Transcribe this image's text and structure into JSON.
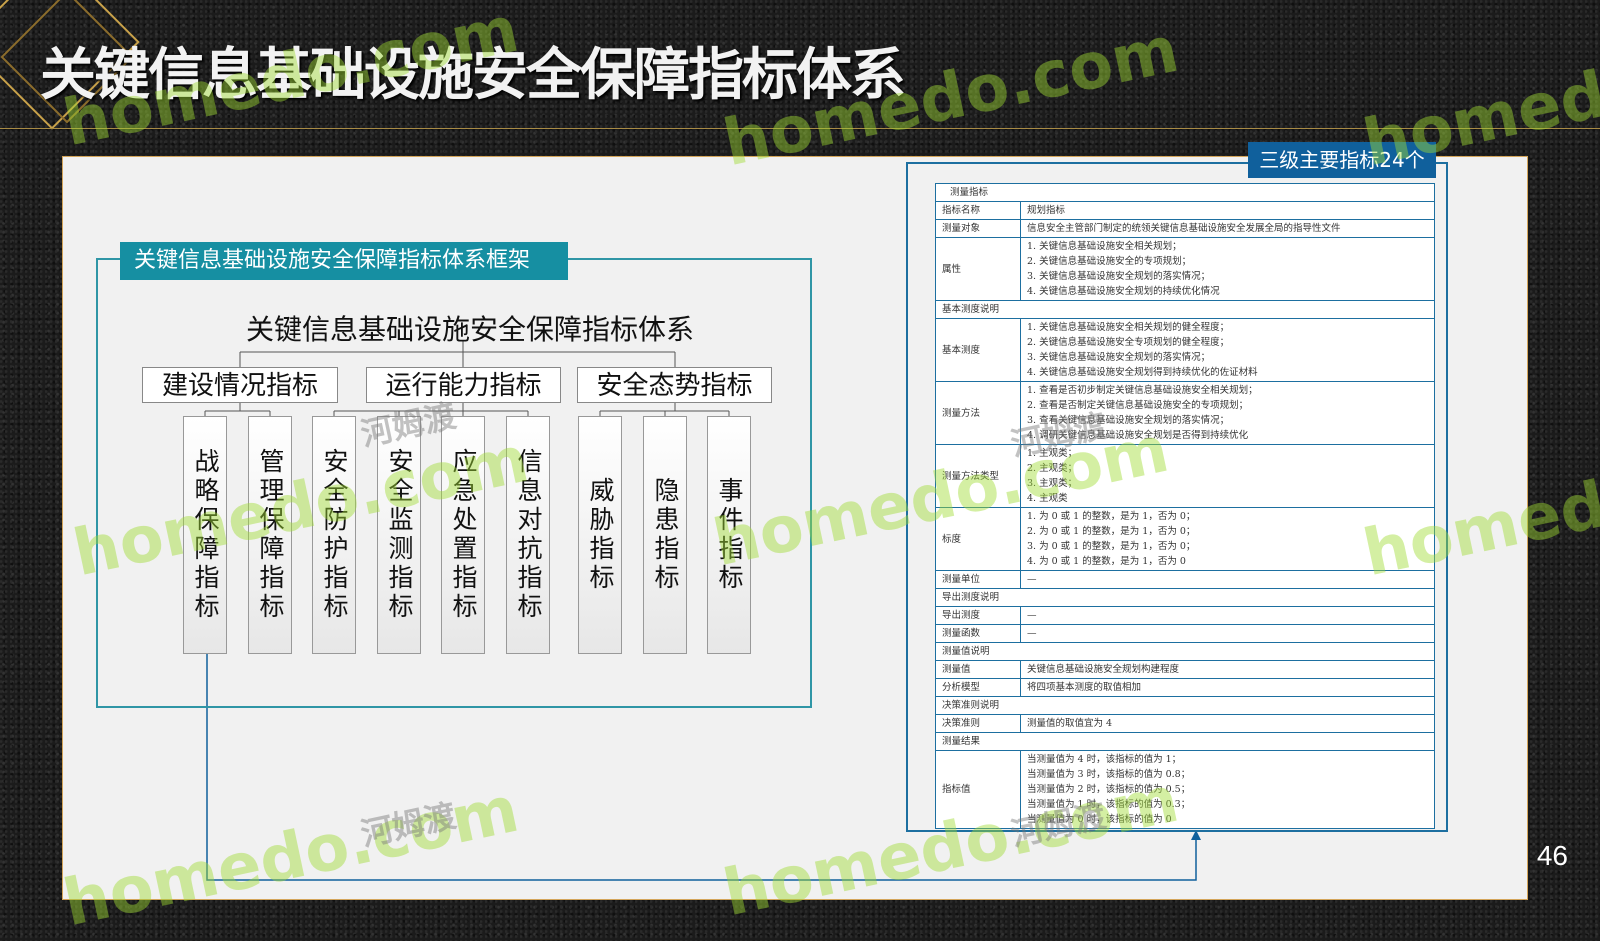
{
  "slide": {
    "title": "关键信息基础设施安全保障指标体系",
    "page_number": "46"
  },
  "framework": {
    "label": "关键信息基础设施安全保障指标体系框架",
    "system_title": "关键信息基础设施安全保障指标体系",
    "categories": [
      {
        "label": "建设情况指标",
        "leaves": [
          "战略保障指标",
          "管理保障指标"
        ]
      },
      {
        "label": "运行能力指标",
        "leaves": [
          "安全防护指标",
          "安全监测指标",
          "应急处置指标",
          "信息对抗指标"
        ]
      },
      {
        "label": "安全态势指标",
        "leaves": [
          "威胁指标",
          "隐患指标",
          "事件指标"
        ]
      }
    ]
  },
  "level_tag": "三级主要指标24个",
  "metric_table": {
    "header": "测量指标",
    "name_key": "指标名称",
    "name_val": "规划指标",
    "object_key": "测量对象",
    "object_val": "信息安全主管部门制定的统领关键信息基础设施安全发展全局的指导性文件",
    "attr_key": "属性",
    "attr_lines": [
      "1. 关键信息基础设施安全相关规划；",
      "2. 关键信息基础设施安全的专项规划；",
      "3. 关键信息基础设施安全规划的落实情况；",
      "4. 关键信息基础设施安全规划的持续优化情况"
    ],
    "basic_desc": "基本测度说明",
    "basic_key": "基本测度",
    "basic_lines": [
      "1. 关键信息基础设施安全相关规划的健全程度；",
      "2. 关键信息基础设施安全专项规划的健全程度；",
      "3. 关键信息基础设施安全规划的落实情况；",
      "4. 关键信息基础设施安全规划得到持续优化的佐证材料"
    ],
    "method_key": "测量方法",
    "method_lines": [
      "1. 查看是否初步制定关键信息基础设施安全相关规划；",
      "2. 查看是否制定关键信息基础设施安全的专项规划；",
      "3. 查看关键信息基础设施安全规划的落实情况；",
      "4. 调研关键信息基础设施安全规划是否得到持续优化"
    ],
    "mtype_key": "测量方法类型",
    "mtype_lines": [
      "1. 主观类；",
      "2. 主观类；",
      "3. 主观类；",
      "4. 主观类"
    ],
    "scale_key": "标度",
    "scale_lines": [
      "1. 为 0 或 1 的整数，是为 1，否为 0；",
      "2. 为 0 或 1 的整数，是为 1，否为 0；",
      "3. 为 0 或 1 的整数，是为 1，否为 0；",
      "4. 为 0 或 1 的整数，是为 1，否为 0"
    ],
    "unit_key": "测量单位",
    "unit_val": "—",
    "derived_desc": "导出测度说明",
    "derived_key": "导出测度",
    "derived_val": "—",
    "func_key": "测量函数",
    "func_val": "—",
    "value_desc": "测量值说明",
    "value_key": "测量值",
    "value_val": "关键信息基础设施安全规划构建程度",
    "model_key": "分析模型",
    "model_val": "将四项基本测度的取值相加",
    "decision_desc": "决策准则说明",
    "decision_key": "决策准则",
    "decision_val": "测量值的取值宜为 4",
    "result_desc": "测量结果",
    "index_key": "指标值",
    "index_lines": [
      "当测量值为 4 时，该指标的值为 1；",
      "当测量值为 3 时，该指标的值为 0.8；",
      "当测量值为 2 时，该指标的值为 0.5；",
      "当测量值为 1 时，该指标的值为 0.3；",
      "当测量值为 0 时，该指标的值为 0"
    ]
  },
  "watermark": {
    "brand": "homedo.com",
    "cn": "河姆渡"
  },
  "colors": {
    "teal": "#168fa2",
    "blue": "#10609c",
    "gold": "#c9a24a"
  }
}
